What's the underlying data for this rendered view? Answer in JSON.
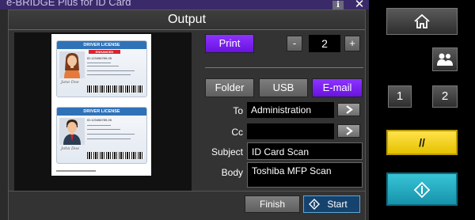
{
  "app": {
    "title": "e-BRIDGE Plus for ID Card",
    "info_label": "i",
    "close_label": "✕"
  },
  "dialog": {
    "title": "Output"
  },
  "preview": {
    "cards": [
      {
        "header": "DRIVER LICENSE",
        "badge": "ENHANCED",
        "id": "ID:123456789-05",
        "signature": "Jane Doe"
      },
      {
        "header": "DRIVER LICENSE",
        "badge": "",
        "id": "ID:123456789-05",
        "signature": "John Doe"
      }
    ]
  },
  "print": {
    "label": "Print",
    "minus_label": "-",
    "plus_label": "+",
    "copies": "2"
  },
  "destinations": {
    "folder": "Folder",
    "usb": "USB",
    "email": "E-mail",
    "selected": "E-mail"
  },
  "form": {
    "to_label": "To",
    "to_value": "Administration",
    "cc_label": "Cc",
    "cc_value": "",
    "subject_label": "Subject",
    "subject_value": "ID Card Scan",
    "body_label": "Body",
    "body_value": "Toshiba MFP Scan"
  },
  "actions": {
    "finish": "Finish",
    "start": "Start"
  },
  "hardware": {
    "home_icon": "home-icon",
    "user_icon": "users-icon",
    "one": "1",
    "two": "2",
    "clear": "//",
    "start_icon": "start-diamond-icon"
  },
  "colors": {
    "accent": "#7a22f5",
    "start_blue": "#1e9fb6",
    "clear_yellow": "#f3d21f"
  }
}
